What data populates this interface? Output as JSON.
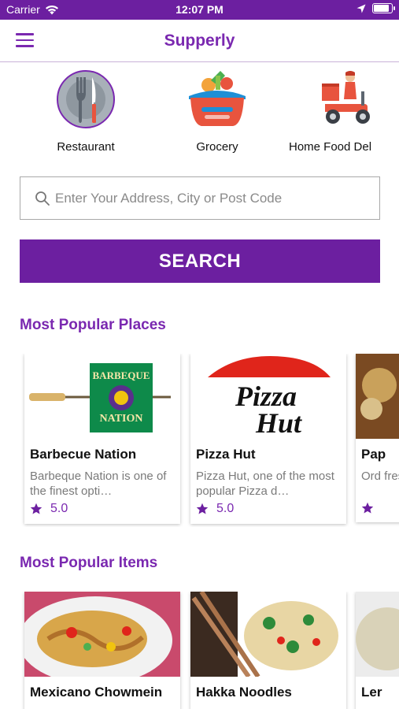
{
  "status_bar": {
    "carrier": "Carrier",
    "time": "12:07 PM",
    "battery_level": 0.9
  },
  "header": {
    "title": "Supperly",
    "menu_icon": "hamburger-menu-icon"
  },
  "categories": [
    {
      "label": "Restaurant",
      "icon": "fork-knife-icon"
    },
    {
      "label": "Grocery",
      "icon": "grocery-basket-icon"
    },
    {
      "label": "Home Food Del",
      "icon": "delivery-scooter-icon"
    }
  ],
  "search": {
    "placeholder": "Enter Your Address, City or Post Code",
    "button_label": "SEARCH"
  },
  "popular_places": {
    "title": "Most Popular Places",
    "cards": [
      {
        "name": "Barbecue Nation",
        "desc": "Barbeque Nation is one of the finest opti…",
        "rating": "5.0",
        "logo_text": "BARBEQUE NATION"
      },
      {
        "name": "Pizza Hut",
        "desc": " Pizza Hut, one of the most popular Pizza d…",
        "rating": "5.0",
        "logo_text": "Pizza Hut"
      },
      {
        "name": "Pap",
        "desc": "Ord fres",
        "rating": ""
      }
    ]
  },
  "popular_items": {
    "title": "Most Popular Items",
    "cards": [
      {
        "name": "Mexicano Chowmein"
      },
      {
        "name": "Hakka Noodles"
      },
      {
        "name": "Ler"
      }
    ]
  },
  "colors": {
    "brand": "#6c1fa0",
    "accent": "#7a28b0"
  }
}
